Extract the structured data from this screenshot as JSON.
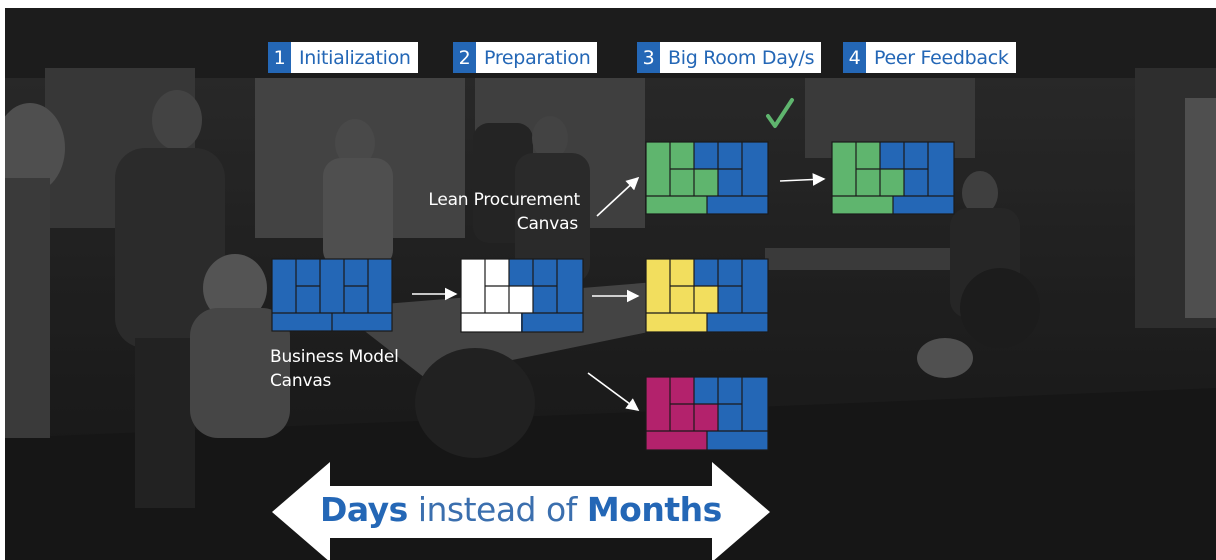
{
  "steps": [
    {
      "number": "1",
      "label": "Initialization"
    },
    {
      "number": "2",
      "label": "Preparation"
    },
    {
      "number": "3",
      "label": "Big Room Day/s"
    },
    {
      "number": "4",
      "label": "Peer Feedback"
    }
  ],
  "captions": {
    "lean_procurement_line1": "Lean Procurement",
    "lean_procurement_line2": "Canvas",
    "business_model_line1": "Business Model",
    "business_model_line2": "Canvas"
  },
  "banner": {
    "word1": "Days",
    "middle": "instead of",
    "word2": "Months"
  },
  "colors": {
    "blue": "#2467b6",
    "green": "#5fb56e",
    "yellow": "#f2de5e",
    "magenta": "#b3226c",
    "white": "#ffffff",
    "check": "#5fb56e"
  },
  "icons": [
    "checkmark-icon",
    "arrow-icon"
  ]
}
